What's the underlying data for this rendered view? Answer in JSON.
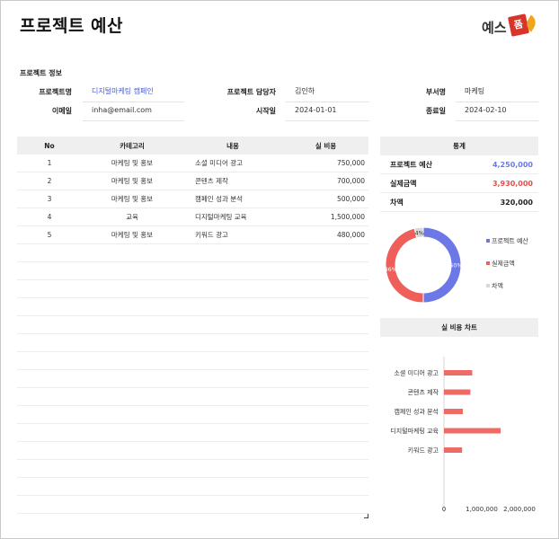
{
  "header": {
    "title": "프로젝트 예산",
    "logo_text": "예스",
    "logo_badge": "폼"
  },
  "info": {
    "section_title": "프로젝트 정보",
    "project_name_label": "프로젝트명",
    "project_name": "디지털마케팅 캠페인",
    "manager_label": "프로젝트 담당자",
    "manager": "김인하",
    "department_label": "부서명",
    "department": "마케팅",
    "email_label": "이메일",
    "email": "inha@email.com",
    "start_label": "시작일",
    "start_date": "2024-01-01",
    "end_label": "종료일",
    "end_date": "2024-02-10"
  },
  "table": {
    "headers": {
      "no": "No",
      "category": "카테고리",
      "description": "내용",
      "cost": "실 비용"
    },
    "rows": [
      {
        "no": "1",
        "category": "마케팅 및 홍보",
        "description": "소셜 미디어 광고",
        "cost": "750,000"
      },
      {
        "no": "2",
        "category": "마케팅 및 홍보",
        "description": "콘텐츠 제작",
        "cost": "700,000"
      },
      {
        "no": "3",
        "category": "마케팅 및 홍보",
        "description": "캠페인 성과 분석",
        "cost": "500,000"
      },
      {
        "no": "4",
        "category": "교육",
        "description": "디지털마케팅 교육",
        "cost": "1,500,000"
      },
      {
        "no": "5",
        "category": "마케팅 및 홍보",
        "description": "키워드 광고",
        "cost": "480,000"
      }
    ]
  },
  "stats": {
    "title": "통계",
    "budget_label": "프로젝트 예산",
    "budget": "4,250,000",
    "actual_label": "실제금액",
    "actual": "3,930,000",
    "diff_label": "차액",
    "diff": "320,000"
  },
  "colors": {
    "blue": "#6b78e6",
    "red": "#ee5f5a",
    "gray": "#d9d9d9",
    "bar": "#ee6b66"
  },
  "chart_data": [
    {
      "type": "pie",
      "title": "",
      "categories": [
        "프로젝트 예산",
        "실제금액",
        "차액"
      ],
      "values": [
        4250000,
        3930000,
        320000
      ],
      "labels": [
        "50%",
        "46%",
        "4%"
      ],
      "legend": "right"
    },
    {
      "type": "bar",
      "orientation": "horizontal",
      "title": "실 비용 차트",
      "categories": [
        "소셜 미디어 광고",
        "콘텐츠 제작",
        "캠페인 성과 분석",
        "디지털마케팅 교육",
        "키워드 광고"
      ],
      "values": [
        750000,
        700000,
        500000,
        1500000,
        480000
      ],
      "xlim": [
        0,
        2000000
      ],
      "ticks": [
        "0",
        "1,000,000",
        "2,000,000"
      ],
      "grid": false
    }
  ]
}
